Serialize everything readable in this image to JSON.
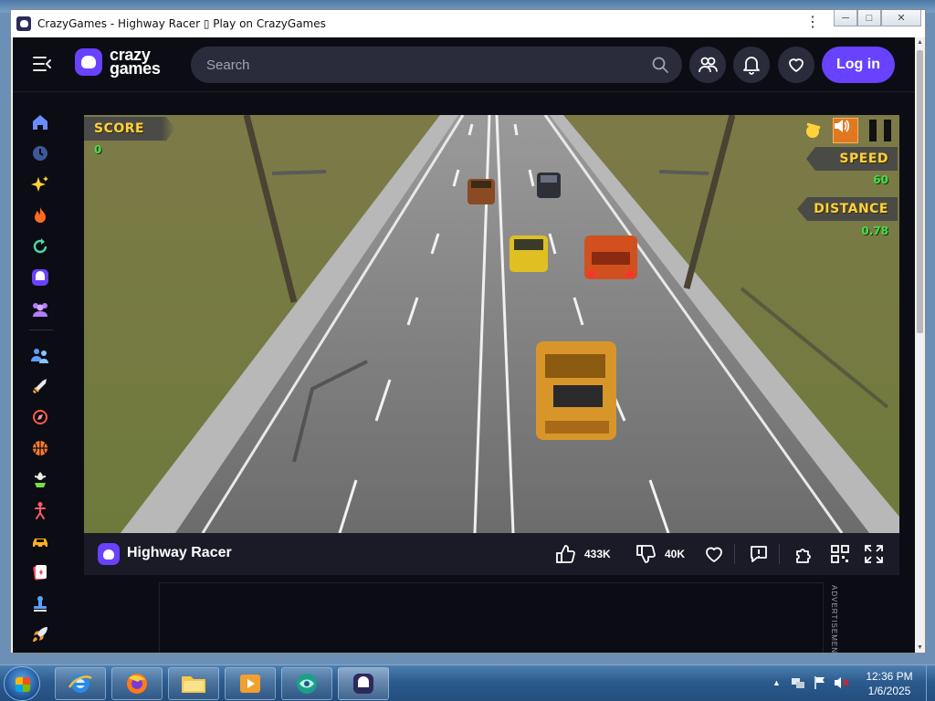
{
  "window": {
    "title": "CrazyGames - Highway Racer ▯ Play on CrazyGames",
    "menu_glyph": "⋮",
    "minimize": "─",
    "maximize": "□",
    "close": "✕"
  },
  "header": {
    "logo_line1": "crazy",
    "logo_line2": "games",
    "search_placeholder": "Search",
    "login_label": "Log in"
  },
  "sidebar": {
    "items": [
      {
        "icon": "home-icon",
        "color": "#6b8cff"
      },
      {
        "icon": "clock-icon",
        "color": "#4a6ea8"
      },
      {
        "icon": "sparkle-icon",
        "color": "#ffd23a"
      },
      {
        "icon": "fire-icon",
        "color": "#ff6a1f"
      },
      {
        "icon": "refresh-icon",
        "color": "#4cd9a8"
      },
      {
        "icon": "crazygames-icon",
        "color": "#7a5cff"
      },
      {
        "icon": "multiplayer-icon",
        "color": "#b27cff"
      },
      {
        "icon": "two-player-icon",
        "color": "#5aa0ff"
      },
      {
        "icon": "sword-icon",
        "color": "#ffb03a"
      },
      {
        "icon": "compass-icon",
        "color": "#ff5a4a"
      },
      {
        "icon": "basketball-icon",
        "color": "#ff7a2a"
      },
      {
        "icon": "flower-icon",
        "color": "#7cd94c"
      },
      {
        "icon": "stickman-icon",
        "color": "#ff5a6a"
      },
      {
        "icon": "car-icon",
        "color": "#ffb020"
      },
      {
        "icon": "cards-icon",
        "color": "#ff4a5a"
      },
      {
        "icon": "stamp-icon",
        "color": "#5aa0ff"
      },
      {
        "icon": "rocket-icon",
        "color": "#ff9a3a"
      }
    ]
  },
  "game": {
    "score_label": "SCORE",
    "score_value": "0",
    "speed_label": "SPEED",
    "speed_value": "60",
    "distance_label": "DISTANCE",
    "distance_value": "0.78"
  },
  "gamebar": {
    "title": "Highway Racer",
    "likes": "433K",
    "dislikes": "40K"
  },
  "ad": {
    "label": "ADVERTISEMEN"
  },
  "taskbar": {
    "time": "12:36 PM",
    "date": "1/6/2025"
  },
  "colors": {
    "accent": "#6842ff",
    "header_bg": "#0c0d14",
    "hud_label": "#ffd23a",
    "hud_value": "#4cd94c"
  }
}
